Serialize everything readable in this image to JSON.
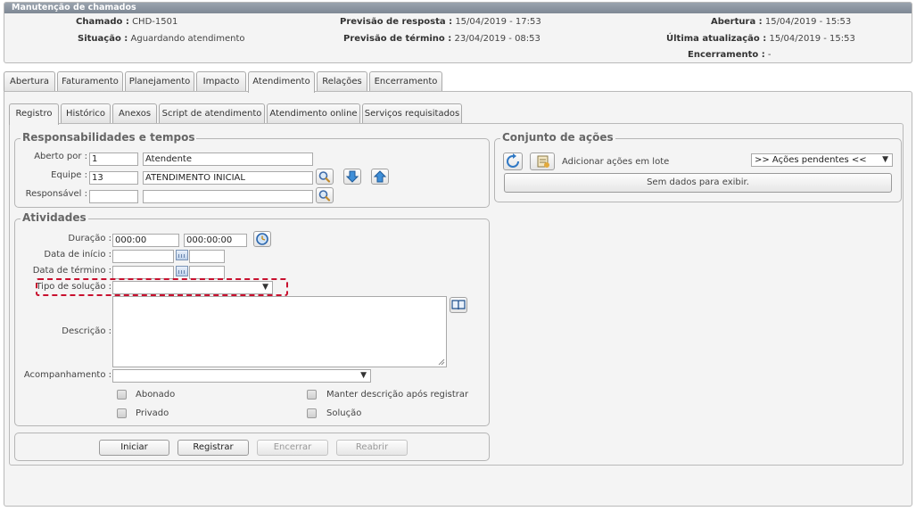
{
  "header": {
    "title": "Manutenção de chamados",
    "chamado_label": "Chamado :",
    "chamado_value": "CHD-1501",
    "situacao_label": "Situação :",
    "situacao_value": "Aguardando atendimento",
    "prev_resposta_label": "Previsão de resposta :",
    "prev_resposta_value": "15/04/2019 - 17:53",
    "prev_termino_label": "Previsão de término :",
    "prev_termino_value": "23/04/2019 - 08:53",
    "abertura_label": "Abertura :",
    "abertura_value": "15/04/2019 - 15:53",
    "ultima_label": "Última atualização :",
    "ultima_value": "15/04/2019 - 15:53",
    "encerramento_label": "Encerramento :",
    "encerramento_value": "-"
  },
  "main_tabs": [
    "Abertura",
    "Faturamento",
    "Planejamento",
    "Impacto",
    "Atendimento",
    "Relações",
    "Encerramento"
  ],
  "sub_tabs": [
    "Registro",
    "Histórico",
    "Anexos",
    "Script de atendimento",
    "Atendimento online",
    "Serviços requisitados"
  ],
  "responsabilidades": {
    "legend": "Responsabilidades e tempos",
    "aberto_por_label": "Aberto por :",
    "aberto_por_code": "1",
    "aberto_por_name": "Atendente",
    "equipe_label": "Equipe :",
    "equipe_code": "13",
    "equipe_name": "ATENDIMENTO INICIAL",
    "responsavel_label": "Responsável :",
    "responsavel_code": "",
    "responsavel_name": ""
  },
  "acoes": {
    "legend": "Conjunto de ações",
    "add_lote_label": "Adicionar ações em lote",
    "select_value": ">> Ações pendentes <<",
    "empty_label": "Sem dados para exibir."
  },
  "atividades": {
    "legend": "Atividades",
    "duracao_label": "Duração :",
    "duracao_1": "000:00",
    "duracao_2": "000:00:00",
    "inicio_label": "Data de início :",
    "termino_label": "Data de término :",
    "tipo_label": "Tipo de solução :",
    "descricao_label": "Descrição :",
    "acompanhamento_label": "Acompanhamento :",
    "abonado_label": "Abonado",
    "privado_label": "Privado",
    "manter_label": "Manter descrição após registrar",
    "solucao_label": "Solução"
  },
  "buttons": {
    "iniciar": "Iniciar",
    "registrar": "Registrar",
    "encerrar": "Encerrar",
    "reabrir": "Reabrir"
  },
  "colors": {
    "highlight": "#c8102e",
    "titlebar": "#8891a0"
  }
}
